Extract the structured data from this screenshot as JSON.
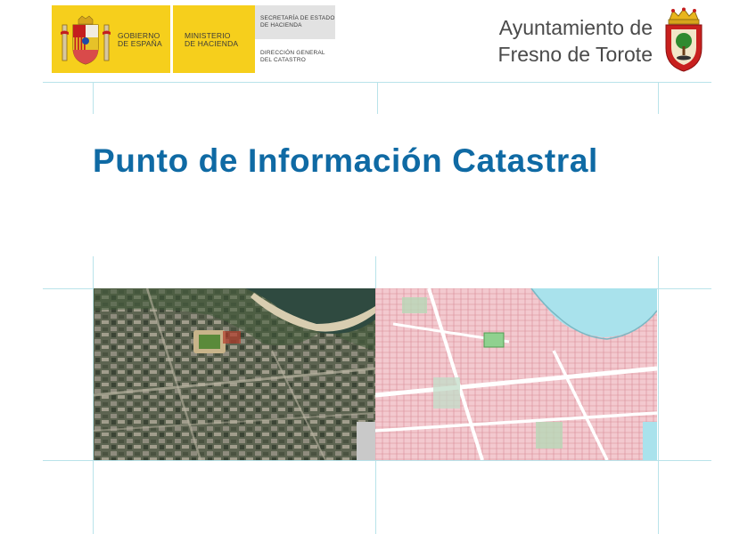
{
  "header": {
    "gobierno": [
      "GOBIERNO",
      "DE ESPAÑA"
    ],
    "ministerio": [
      "MINISTERIO",
      "DE HACIENDA"
    ],
    "secretaria": [
      "SECRETARÍA DE ESTADO",
      "DE HACIENDA"
    ],
    "direccion": [
      "DIRECCIÓN GENERAL",
      "DEL CATASTRO"
    ],
    "ayuntamiento": [
      "Ayuntamiento de",
      "Fresno de Torote"
    ]
  },
  "main": {
    "title": "Punto de Información Catastral"
  },
  "colors": {
    "title_blue": "#0f6aa4",
    "gov_yellow": "#f6cf1c",
    "guide_lines": "#b9e3ea"
  },
  "icons": [
    "royal-coat-of-arms-icon",
    "municipal-shield-icon"
  ],
  "images": [
    "aerial-orthophoto",
    "cadastral-map"
  ]
}
